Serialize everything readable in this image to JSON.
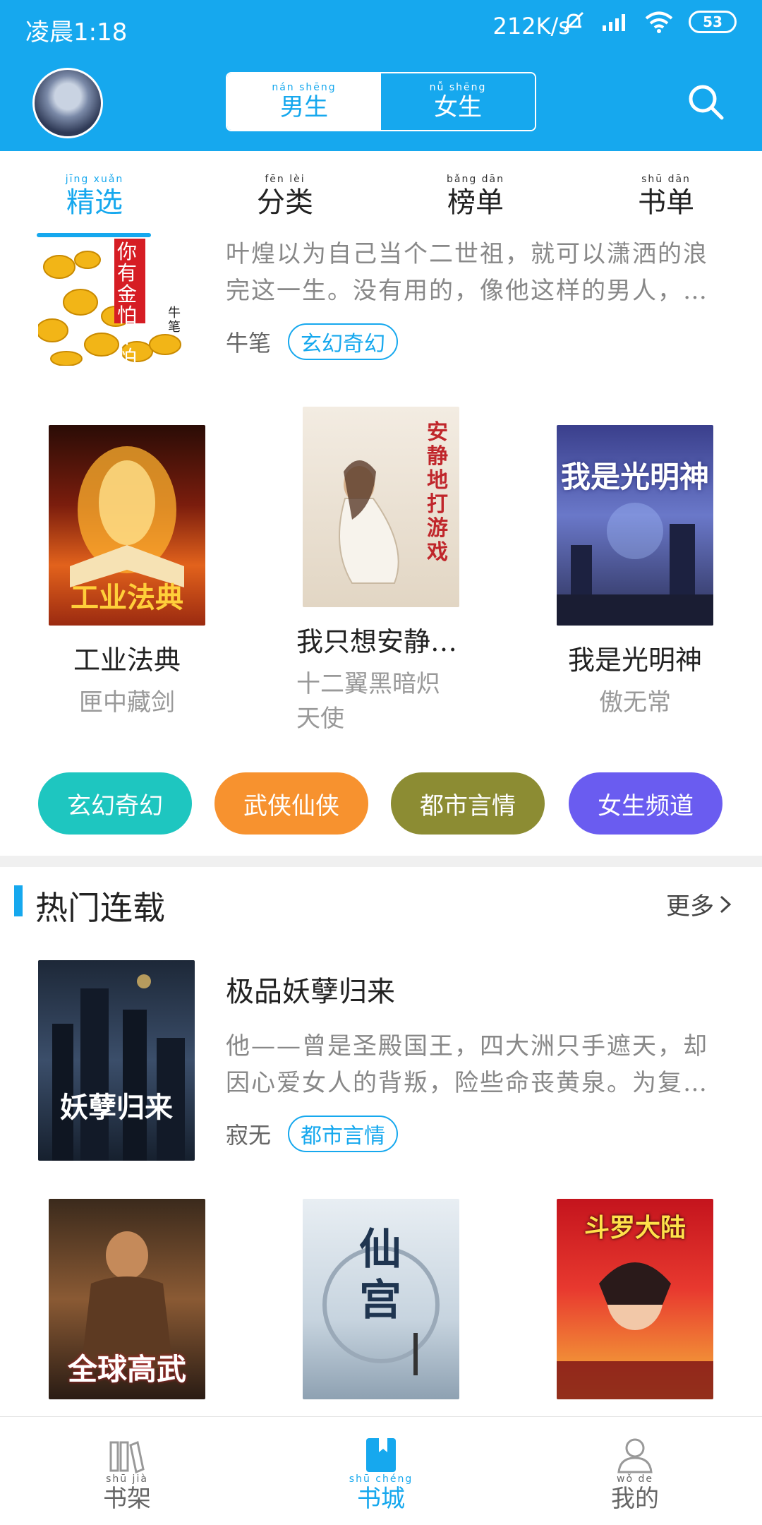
{
  "status_bar": {
    "time": "凌晨1:18",
    "network_speed": "212K/s",
    "battery": "53"
  },
  "header": {
    "gender_tabs": [
      {
        "pinyin": "nán shēng",
        "label": "男生"
      },
      {
        "pinyin": "nǚ shēng",
        "label": "女生"
      }
    ]
  },
  "tabs": [
    {
      "pinyin": "jīng xuǎn",
      "label": "精选"
    },
    {
      "pinyin": "fēn lèi",
      "label": "分类"
    },
    {
      "pinyin": "bǎng dān",
      "label": "榜单"
    },
    {
      "pinyin": "shū dān",
      "label": "书单"
    }
  ],
  "featured_top": {
    "desc": "叶煌以为自己当个二世祖，就可以潇洒的浪完这一生。没有用的，像他这样的男人，…",
    "desc_line1": "叶煌以为自己当个二世祖，就可以潇洒的浪",
    "desc_line2": "完这一生。没有用的，像他这样的男人，…",
    "author": "牛笔",
    "tag": "玄幻奇幻",
    "cover_title": "你有金怕不怕",
    "cover_author": "牛笔"
  },
  "grid_row1": [
    {
      "title": "工业法典",
      "author": "匣中藏剑",
      "cover_text": "工业法典"
    },
    {
      "title": "我只想安静…",
      "author": "十二翼黑暗炽天使",
      "author_line1": "十二翼黑暗炽",
      "author_line2": "天使",
      "cover_text": "安静地打游戏"
    },
    {
      "title": "我是光明神",
      "author": "傲无常",
      "cover_text": "我是光明神"
    }
  ],
  "category_buttons": [
    {
      "label": "玄幻奇幻",
      "color": "#1ec6c0"
    },
    {
      "label": "武侠仙侠",
      "color": "#f7922f"
    },
    {
      "label": "都市言情",
      "color": "#8c8c33"
    },
    {
      "label": "女生频道",
      "color": "#6a5cf0"
    }
  ],
  "hot_section": {
    "title": "热门连载",
    "more": "更多"
  },
  "featured_hot": {
    "title": "极品妖孽归来",
    "desc_line1": "他——曾是圣殿国王，四大洲只手遮天，却",
    "desc_line2": "因心爱女人的背叛，险些命丧黄泉。为复…",
    "author": "寂无",
    "tag": "都市言情",
    "cover_text": "妖孽归来"
  },
  "grid_row2": [
    {
      "cover_text": "全球高武"
    },
    {
      "cover_text": "仙宫"
    },
    {
      "cover_text": "斗罗大陆"
    }
  ],
  "bottom_nav": [
    {
      "label": "书架",
      "pinyin": "shū jià"
    },
    {
      "label": "书城",
      "pinyin": "shū chéng"
    },
    {
      "label": "我的",
      "pinyin": "wǒ de"
    }
  ]
}
